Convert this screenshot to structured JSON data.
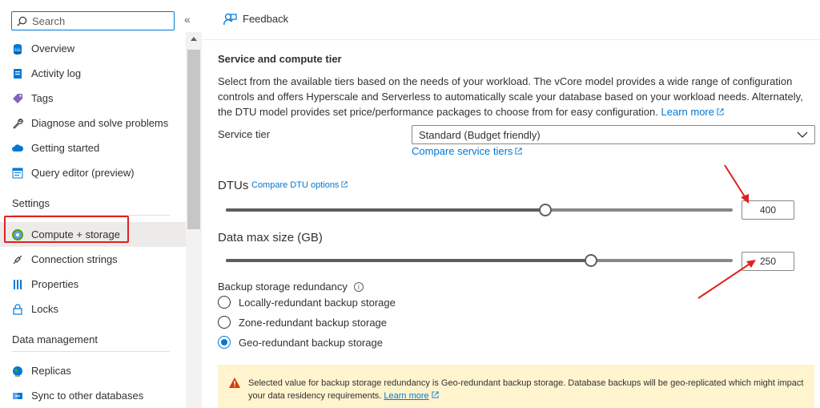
{
  "sidebar": {
    "search_placeholder": "Search",
    "collapse_glyph": "«",
    "items": [
      {
        "label": "Overview",
        "icon": "sql-database-icon"
      },
      {
        "label": "Activity log",
        "icon": "activity-log-icon"
      },
      {
        "label": "Tags",
        "icon": "tag-icon"
      },
      {
        "label": "Diagnose and solve problems",
        "icon": "wrench-icon"
      },
      {
        "label": "Getting started",
        "icon": "cloud-icon"
      },
      {
        "label": "Query editor (preview)",
        "icon": "query-editor-icon"
      }
    ],
    "settings_heading": "Settings",
    "settings_items": [
      {
        "label": "Compute + storage",
        "icon": "compute-storage-icon",
        "selected": true
      },
      {
        "label": "Connection strings",
        "icon": "plug-icon"
      },
      {
        "label": "Properties",
        "icon": "properties-icon"
      },
      {
        "label": "Locks",
        "icon": "lock-icon"
      }
    ],
    "data_heading": "Data management",
    "data_items": [
      {
        "label": "Replicas",
        "icon": "globe-icon"
      },
      {
        "label": "Sync to other databases",
        "icon": "sync-icon"
      }
    ]
  },
  "toolbar": {
    "feedback_label": "Feedback"
  },
  "main": {
    "title": "Service and compute tier",
    "description": "Select from the available tiers based on the needs of your workload. The vCore model provides a wide range of configuration controls and offers Hyperscale and Serverless to automatically scale your database based on your workload needs. Alternately, the DTU model provides set price/performance packages to choose from for easy configuration.",
    "learn_more": "Learn more",
    "service_tier_label": "Service tier",
    "service_tier_value": "Standard (Budget friendly)",
    "compare_tiers": "Compare service tiers",
    "dtu_label": "DTUs",
    "dtu_compare": "Compare DTU options",
    "dtu_value": "400",
    "dtu_fraction": 0.63,
    "datamax_label": "Data max size (GB)",
    "datamax_value": "250",
    "datamax_fraction": 0.72,
    "backup_label": "Backup storage redundancy",
    "backup_options": [
      {
        "label": "Locally-redundant backup storage",
        "selected": false
      },
      {
        "label": "Zone-redundant backup storage",
        "selected": false
      },
      {
        "label": "Geo-redundant backup storage",
        "selected": true
      }
    ],
    "warning_text": "Selected value for backup storage redundancy is Geo-redundant backup storage. Database backups will be geo-replicated which might impact your data residency requirements.",
    "warning_learn_more": "Learn more"
  },
  "colors": {
    "accent": "#0078d4",
    "highlight": "#e02020",
    "warning_bg": "#fff4ce"
  }
}
